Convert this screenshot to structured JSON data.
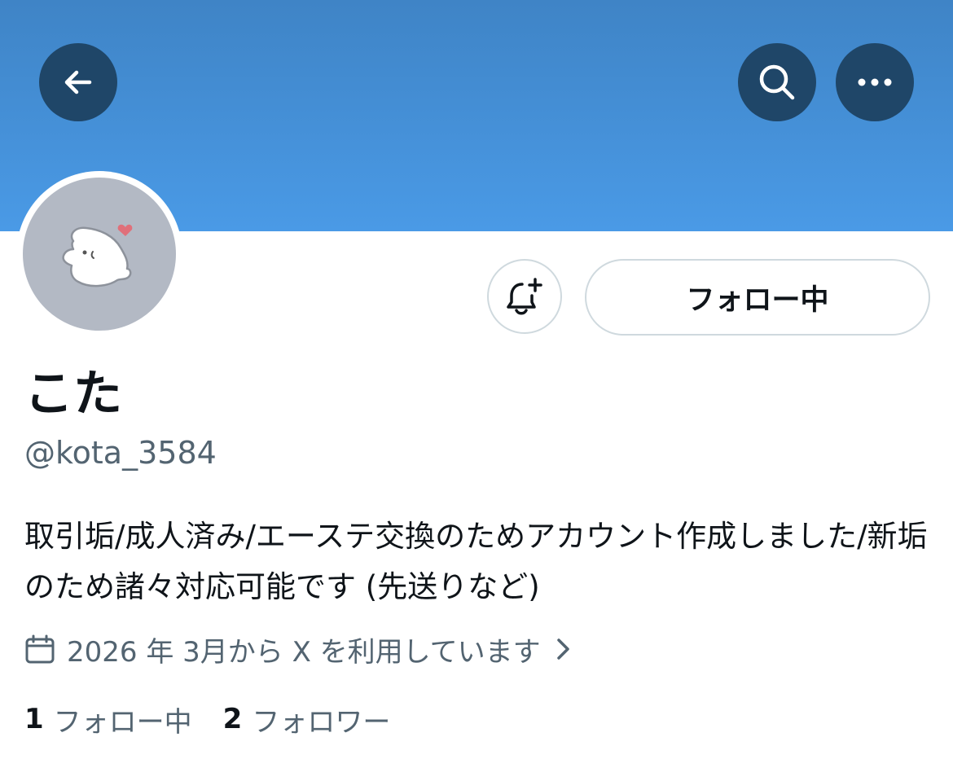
{
  "header": {
    "back_icon": "arrow-left-icon",
    "search_icon": "search-icon",
    "more_icon": "more-horizontal-icon",
    "banner_color": "#4a9ae6"
  },
  "profile": {
    "display_name": "こた",
    "handle": "@kota_3584",
    "bio": "取引垢/成人済み/エーステ交換のためアカウント作成しました/新垢のため諸々対応可能です (先送りなど)",
    "joined": "2026 年 3月から X を利用しています",
    "avatar_icon": "ghost-avatar-icon"
  },
  "actions": {
    "notify_icon": "bell-plus-icon",
    "follow_label": "フォロー中"
  },
  "stats": {
    "following_count": "1",
    "following_label": "フォロー中",
    "followers_count": "2",
    "followers_label": "フォロワー"
  },
  "colors": {
    "text_primary": "#0f1419",
    "text_secondary": "#536471",
    "button_dark": "#1f4668",
    "border": "#cfd9de"
  }
}
